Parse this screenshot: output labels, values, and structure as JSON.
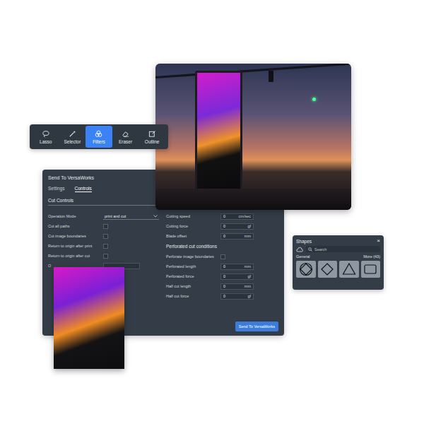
{
  "toolbar": {
    "tools": [
      {
        "label": "Lasso",
        "selected": false
      },
      {
        "label": "Selector",
        "selected": false
      },
      {
        "label": "Filters",
        "selected": true
      },
      {
        "label": "Eraser",
        "selected": false
      },
      {
        "label": "Outline",
        "selected": false
      }
    ]
  },
  "dialog": {
    "title": "Send To VersaWorks",
    "tabs": [
      {
        "label": "Settings",
        "selected": false
      },
      {
        "label": "Controls",
        "selected": true
      }
    ],
    "section": "Cut Controls",
    "left_rows": [
      {
        "kind": "select",
        "label": "Operation Mode",
        "value": "print and cut"
      },
      {
        "kind": "checkbox",
        "label": "Cut all paths",
        "checked": false
      },
      {
        "kind": "checkbox",
        "label": "Cut image boundaries",
        "checked": false
      },
      {
        "kind": "checkbox",
        "label": "Return to origin after print",
        "checked": false
      },
      {
        "kind": "checkbox",
        "label": "Return to origin after cut",
        "checked": false
      },
      {
        "kind": "field",
        "label": "O",
        "value": "",
        "unit": ""
      }
    ],
    "right_rows": [
      {
        "kind": "field",
        "label": "Cutting speed",
        "value": "0",
        "unit": "cm/sec"
      },
      {
        "kind": "field",
        "label": "Cutting force",
        "value": "0",
        "unit": "gf"
      },
      {
        "kind": "field",
        "label": "Blade offset",
        "value": "0",
        "unit": "mm"
      },
      {
        "kind": "heading",
        "label": "Perforated cut conditions"
      },
      {
        "kind": "checkbox",
        "label": "Perforate image boundaries",
        "checked": false
      },
      {
        "kind": "field",
        "label": "Perforated length",
        "value": "0",
        "unit": "mm"
      },
      {
        "kind": "field",
        "label": "Perforated force",
        "value": "0",
        "unit": "gf"
      },
      {
        "kind": "field",
        "label": "Half cut length",
        "value": "0",
        "unit": "mm"
      },
      {
        "kind": "field",
        "label": "Half cut force",
        "value": "0",
        "unit": "gf"
      }
    ],
    "button": "Send To VersaWorks"
  },
  "shapes_panel": {
    "title": "Shapes",
    "close": "×",
    "search": {
      "placeholder": "Search"
    },
    "category": "General",
    "more": "More (43)",
    "shapes": [
      {
        "kind": "diamond-circle"
      },
      {
        "kind": "diamond"
      },
      {
        "kind": "triangle"
      },
      {
        "kind": "rectangle"
      }
    ]
  }
}
